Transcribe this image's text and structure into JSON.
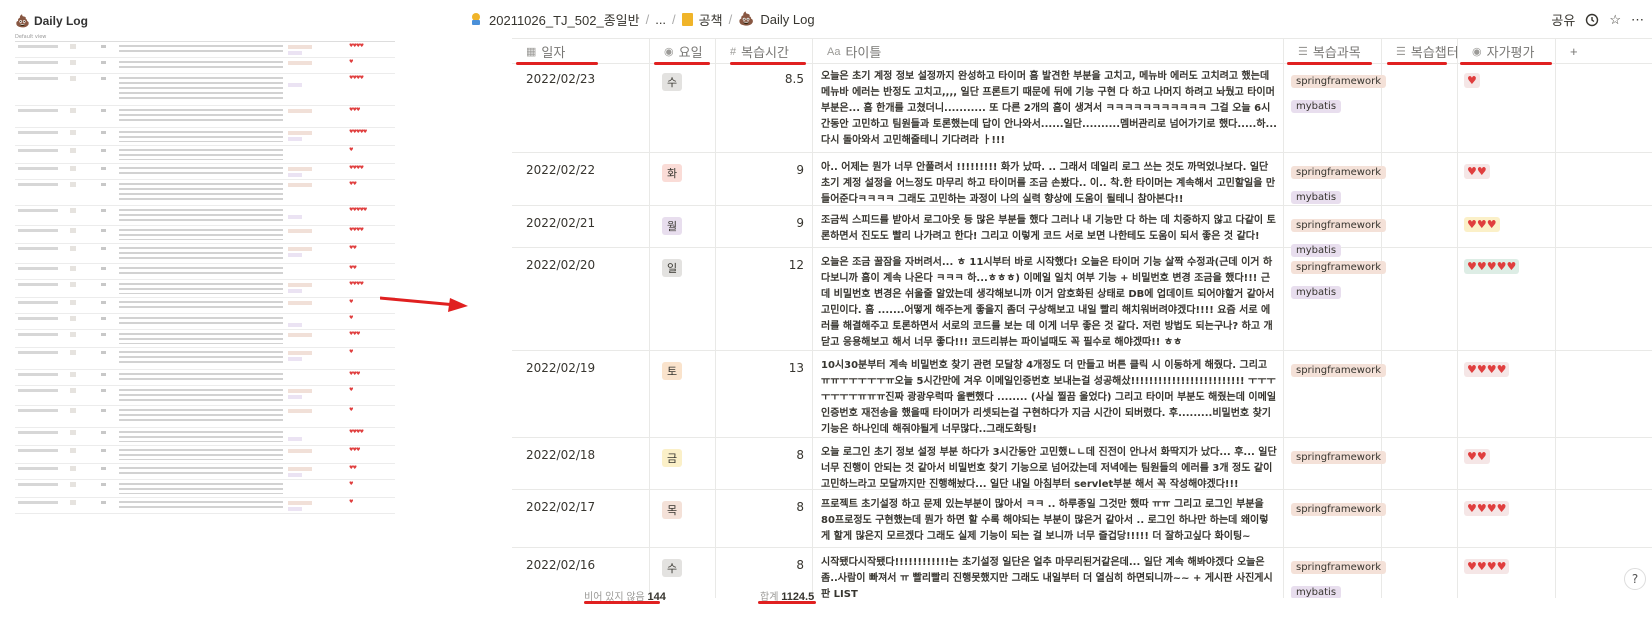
{
  "thumbnail": {
    "title": "Daily Log",
    "view_label": "Default view",
    "ratings": [
      "♥♥♥♥",
      "♥",
      "♥♥♥♥",
      "♥♥♥",
      "♥♥♥♥♥",
      "♥",
      "♥♥♥♥",
      "♥♥",
      "♥♥♥♥♥",
      "♥♥♥♥",
      "♥♥",
      "♥♥",
      "♥♥♥♥",
      "♥",
      "♥",
      "♥♥♥",
      "♥",
      "♥♥♥",
      "♥",
      "♥",
      "♥♥♥♥",
      "♥♥♥",
      "♥♥",
      "♥",
      "♥"
    ]
  },
  "breadcrumb": {
    "workspace": "20211026_TJ_502_종일반",
    "ellipsis": "...",
    "folder": "공책",
    "page": "Daily Log"
  },
  "toolbar": {
    "share": "공유",
    "history_icon": "clock-icon",
    "favorite_icon": "star-icon",
    "more": "⋯"
  },
  "columns": {
    "date": "일자",
    "day": "요일",
    "hours": "복습시간",
    "title": "타이틀",
    "subject": "복습과목",
    "chapter": "복습챕터",
    "rating": "자가평가",
    "add": "+"
  },
  "colors": {
    "accent_red": "#e02020",
    "heart": "#e03e3e"
  },
  "rows": [
    {
      "date": "2022/02/23",
      "day": "수",
      "day_color": "#e3e2e0",
      "hours": "8.5",
      "title": "오늘은 초기 계정 정보 설정까지 완성하고 타이머 흠 발견한 부분을 고치고, 메뉴바 에러도 고치려고 했는데 메뉴바 에러는 반정도 고치고,,,, 일단 프론트기 때문에 뒤에 기능 구현 다 하고 나머지 하려고 놔뒀고 타이머 부분은... 흠 한개를 고쳤더니........... 또 다른 2개의 흠이 생겨서 ㅋㅋㅋㅋㅋㅋㅋㅋㅋㅋㅋ 그걸 오늘 6시간동안 고민하고 팀원들과 토론했는데 답이 안나와서......일단..........멤버관리로 넘어가기로 했다.....하...다시 돌아와서 고민해줄테니 기다려라 ㅏ!!!",
      "subjects": [
        "springframework",
        "mybatis"
      ],
      "rating": "♥",
      "rating_style": "pink"
    },
    {
      "date": "2022/02/22",
      "day": "화",
      "day_color": "#fadcd7",
      "hours": "9",
      "title": "아.. 어제는 뭔가 너무 안풀려서 !!!!!!!!! 화가 났따. .. 그래서 데일리 로그 쓰는 것도 까먹었나보다. 일단 초기 계정 설정을 어느정도 마무리 하고 타이머를 조금 손봤다.. 이.. 착.한 타이머는 계속해서 고민할일을 만들어준다ㅋㅋㅋㅋ 그래도 고민하는 과정이 나의 실력 향상에 도움이 될테니 참아본다!!",
      "subjects": [
        "springframework",
        "mybatis"
      ],
      "rating": "♥♥",
      "rating_style": "pink"
    },
    {
      "date": "2022/02/21",
      "day": "월",
      "day_color": "#e8deee",
      "hours": "9",
      "title": "조금씩 스피드를 받아서 로그아웃 등 많은 부분들 했다 그러나 내 기능만 다 하는 데 치중하지 않고 다같이 토론하면서 진도도 빨리 나가려고 한다! 그리고 이렇게 코드 서로 보면 나한테도 도움이 되서 좋은 것 같다!",
      "subjects": [
        "springframework",
        "mybatis"
      ],
      "rating": "♥♥♥",
      "rating_style": "yellow"
    },
    {
      "date": "2022/02/20",
      "day": "일",
      "day_color": "#e3e2e0",
      "hours": "12",
      "title": "오늘은 조금 꿀잠을 자버려서... ㅎ 11시부터 바로 시작했다! 오늘은 타이머 기능 살짝 수정과(근데 이거 하다보니까 흠이 계속 나온다 ㅋㅋㅋ 하...ㅎㅎㅎ) 이메일 일치 여부 기능 + 비밀번호 변경 조금을 했다!!! 근데 비밀번호 변경은 쉬울줄 알았는데 생각해보니까 이거 암호화된 상태로 DB에 업데이트 되어야할거 같아서 고민이다. 흠 .......어떻게 해주는게 좋을지 좀더 구상해보고 내일 빨리 해치워버려야겠다!!!! 요즘 서로 에러를 해결해주고 토론하면서 서로의 코드를 보는 데 이게 너무 좋은 것 같다. 저런 방법도 되는구나? 하고 개닫고 응용해보고 해서 너무 좋다!!! 코드리뷰는 파이널때도 꼭 필수로 해야겠따!! ㅎㅎ",
      "subjects": [
        "springframework",
        "mybatis"
      ],
      "rating": "♥♥♥♥♥",
      "rating_style": "green"
    },
    {
      "date": "2022/02/19",
      "day": "토",
      "day_color": "#fae3cc",
      "hours": "13",
      "title": "10시30분부터 계속 비밀번호 찾기 관련 모달창 4개정도 더 만들고 버튼 클릭 시 이동하게 해줬다. 그리고 ㅠㅠㅜㅜㅜㅜㅜㅠ오늘 5시간만에 겨우 이메일인증번호 보내는걸 성공해샀!!!!!!!!!!!!!!!!!!!!!!!!! ㅜㅜㅜㅜㅜㅜㅜㅠㅠㅠ진짜 광광우럭따 울뻔했다 ........ (사실 찔끔 울었다) 그리고 타이머 부분도 해줬는데 이메일 인증번호 재전송을 했을때 타이머가 리셋되는걸 구현하다가 지금 시간이 되버렸다. 후.........비밀번호 찾기 기능은 하나인데 해줘야될게 너무많다..그래도화팅!",
      "subjects": [
        "springframework"
      ],
      "rating": "♥♥♥♥",
      "rating_style": "pink"
    },
    {
      "date": "2022/02/18",
      "day": "금",
      "day_color": "#fbf0c8",
      "hours": "8",
      "title": "오늘 로그인 초기 정보 설정 부분 하다가 3시간동안 고민했ㄴㄴ데 진전이 안나서 화딱지가 났다... 후... 일단 너무 진행이 안되는 것 같아서 비밀번호 찾기 기능으로 넘어갔는데 저녁에는 팀원들의 에러를 3개 정도 같이 고민하느라고 모달까지만 진행해놨다... 일단 내일 아침부터 servlet부분 해서 꼭 작성해야겠다!!!",
      "subjects": [
        "springframework"
      ],
      "rating": "♥♥",
      "rating_style": "pink"
    },
    {
      "date": "2022/02/17",
      "day": "목",
      "day_color": "#f4e1d8",
      "hours": "8",
      "title": "프로젝트 초기설정 하고 문제 있는부분이 많아서 ㅋㅋ .. 하루종일 그것만 했따 ㅠㅠ 그리고 로그인 부분을 80프로정도 구현했는데 뭔가 하면 할 수록 해야되는 부분이 많은거 같아서 .. 로그인 하나만 하는데 왜이렇게 할게 많은지 모르겠다 그래도 실제 기능이 되는 걸 보니까 너무 즐겁당!!!!! 더 잘하고싶다 화이팅~",
      "subjects": [
        "springframework"
      ],
      "rating": "♥♥♥♥",
      "rating_style": "pink"
    },
    {
      "date": "2022/02/16",
      "day": "수",
      "day_color": "#e3e2e0",
      "hours": "8",
      "title": "시작됐다시작됐다!!!!!!!!!!!!는 초기설정 일단은 얼추 마무리된거같은데... 일단 계속 해봐야겠다 오늘은 좀..사람이 빠져서 ㅠ 빨리빨리 진행못했지만 그래도 내일부터 더 열심히 하면되니까~~ + 게시판 사진게시판 LIST",
      "subjects": [
        "springframework",
        "mybatis"
      ],
      "rating": "♥♥♥♥",
      "rating_style": "pink"
    }
  ],
  "footer": {
    "empty_label": "비어 있지 않음",
    "empty_value": "144",
    "sum_label": "합계",
    "sum_value": "1124.5"
  },
  "help": "?"
}
